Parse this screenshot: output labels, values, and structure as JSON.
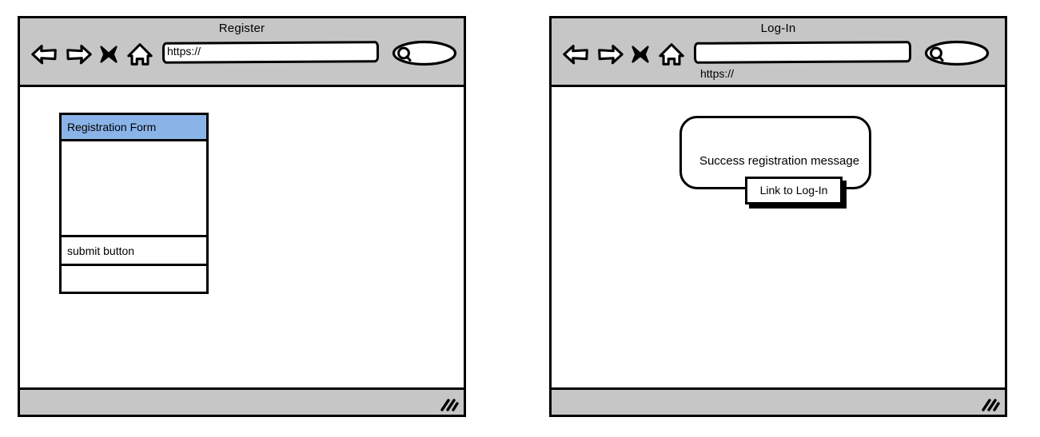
{
  "windows": [
    {
      "id": "register",
      "title": "Register",
      "toolbar": {
        "back_icon": "back-arrow-icon",
        "forward_icon": "forward-arrow-icon",
        "stop_icon": "close-x-icon",
        "home_icon": "home-icon",
        "url_value": "https://",
        "url_placeholder": "https://",
        "url_text_position": "inside",
        "search_icon": "search-magnifier-icon",
        "search_value": ""
      },
      "content": {
        "form": {
          "header_label": "Registration Form",
          "header_color": "#8ab4e8",
          "body_label": "",
          "submit_label": "submit button",
          "footer_label": ""
        }
      },
      "statusbar": {
        "text": "",
        "resize_grip_icon": "resize-grip-icon"
      }
    },
    {
      "id": "login",
      "title": "Log-In",
      "toolbar": {
        "back_icon": "back-arrow-icon",
        "forward_icon": "forward-arrow-icon",
        "stop_icon": "close-x-icon",
        "home_icon": "home-icon",
        "url_value": "",
        "url_placeholder": "https://",
        "url_caption": "https://",
        "url_text_position": "below",
        "search_icon": "search-magnifier-icon",
        "search_value": ""
      },
      "content": {
        "dialog": {
          "message": "Success registration message",
          "link_label": "Link to Log-In"
        }
      },
      "statusbar": {
        "text": "",
        "resize_grip_icon": "resize-grip-icon"
      }
    }
  ],
  "colors": {
    "chrome_gray": "#c6c6c6",
    "outline_black": "#000000",
    "page_white": "#ffffff",
    "form_header_blue": "#8ab4e8"
  }
}
